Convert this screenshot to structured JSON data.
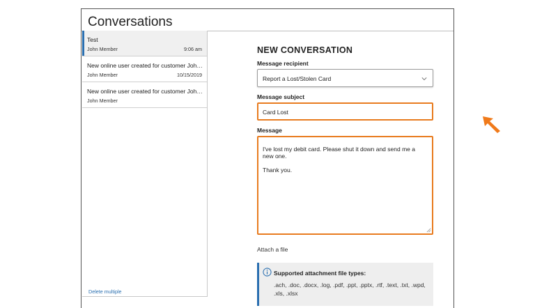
{
  "page": {
    "title": "Conversations"
  },
  "conversations": [
    {
      "subject": "Test",
      "sender": "John Member",
      "date": "9:06 am",
      "selected": true
    },
    {
      "subject": "New online user created for customer John...",
      "sender": "John Member",
      "date": "10/15/2019",
      "selected": false
    },
    {
      "subject": "New online user created for customer John...",
      "sender": "John Member",
      "date": "",
      "selected": false
    }
  ],
  "list_actions": {
    "delete_multiple": "Delete multiple"
  },
  "compose": {
    "title": "NEW CONVERSATION",
    "recipient_label": "Message recipient",
    "recipient_value": "Report a Lost/Stolen Card",
    "subject_label": "Message subject",
    "subject_value": "Card Lost",
    "message_label": "Message",
    "message_value": "I've lost my debit card. Please shut it down and send me a new one.\n\nThank you.",
    "attach_label": "Attach a file"
  },
  "attachment_info": {
    "title": "Supported attachment file types:",
    "types": ".ach, .doc, .docx, .log, .pdf, .ppt, .pptx, .rtf, .text, .txt, .wpd, .xls, .xlsx"
  },
  "colors": {
    "accent": "#2a6fb0",
    "focus": "#e87b1e",
    "cursor": "#f07a1a"
  },
  "icons": {
    "dropdown": "chevron-down-icon",
    "info": "info-icon",
    "pointer": "cursor-arrow-icon"
  }
}
